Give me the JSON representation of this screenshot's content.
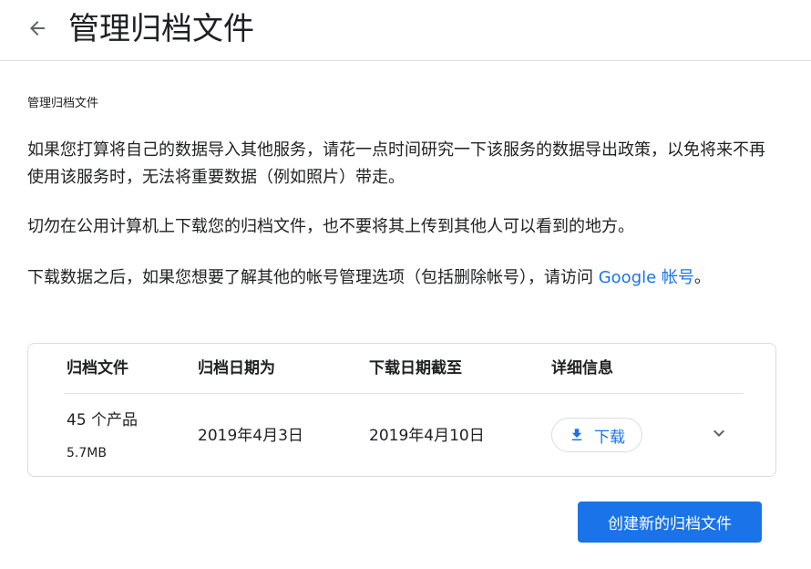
{
  "header": {
    "title": "管理归档文件",
    "back_icon": "arrow-back-icon"
  },
  "section_label": "管理归档文件",
  "paragraphs": {
    "p1": "如果您打算将自己的数据导入其他服务，请花一点时间研究一下该服务的数据导出政策，以免将来不再使用该服务时，无法将重要数据（例如照片）带走。",
    "p2": "切勿在公用计算机上下载您的归档文件，也不要将其上传到其他人可以看到的地方。",
    "p3_prefix": "下载数据之后，如果您想要了解其他的帐号管理选项（包括删除帐号），请访问 ",
    "p3_link": "Google 帐号",
    "p3_suffix": "。"
  },
  "table": {
    "headers": [
      "归档文件",
      "归档日期为",
      "下载日期截至",
      "详细信息"
    ],
    "row": {
      "products": "45 个产品",
      "size": "5.7MB",
      "archive_date": "2019年4月3日",
      "download_until": "2019年4月10日",
      "download_label": "下载",
      "download_icon": "download-icon",
      "expand_icon": "chevron-down-icon"
    }
  },
  "create_button_label": "创建新的归档文件",
  "colors": {
    "accent": "#1a73e8",
    "text": "#202124",
    "border": "#dadce0"
  }
}
